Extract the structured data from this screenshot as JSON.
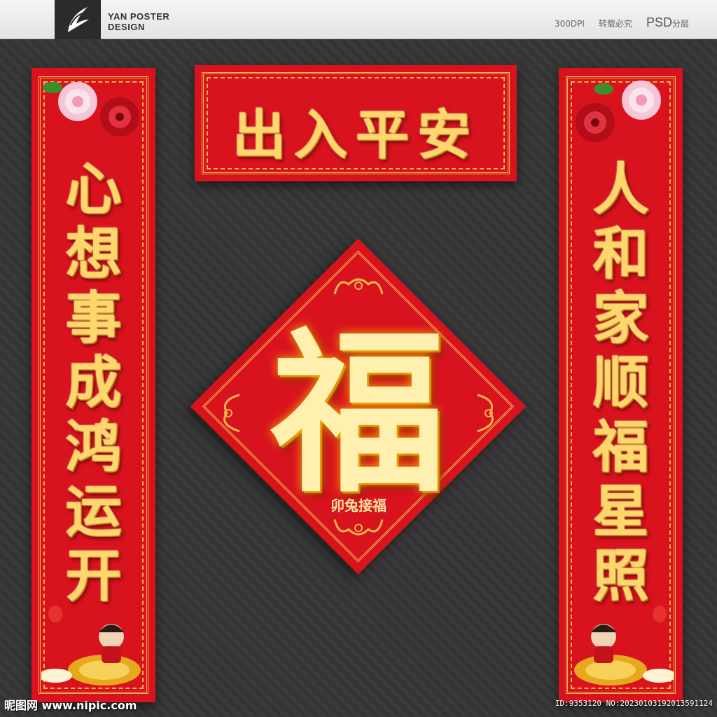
{
  "header": {
    "brand_line1": "YAN POSTER",
    "brand_line2": "DESIGN",
    "dpi": "300DPI",
    "notice": "转载必究",
    "format": "PSD",
    "format_suffix": "分层"
  },
  "banner": {
    "text": "出入平安"
  },
  "left_couplet": {
    "chars": [
      "心",
      "想",
      "事",
      "成",
      "鸿",
      "运",
      "开"
    ]
  },
  "right_couplet": {
    "chars": [
      "人",
      "和",
      "家",
      "顺",
      "福",
      "星",
      "照"
    ]
  },
  "center": {
    "main": "福",
    "seal": "卯兔接福"
  },
  "watermark": {
    "site": "昵图网 www.nipic.com",
    "id": "ID:9353120 NO:20230103192013591124"
  },
  "colors": {
    "paper_red": "#d8131e",
    "gold": "#ffd66b",
    "border_gold": "#f3b44e"
  },
  "icons": [
    "logo-mark",
    "peony-flower-icon",
    "child-on-carp-icon"
  ]
}
